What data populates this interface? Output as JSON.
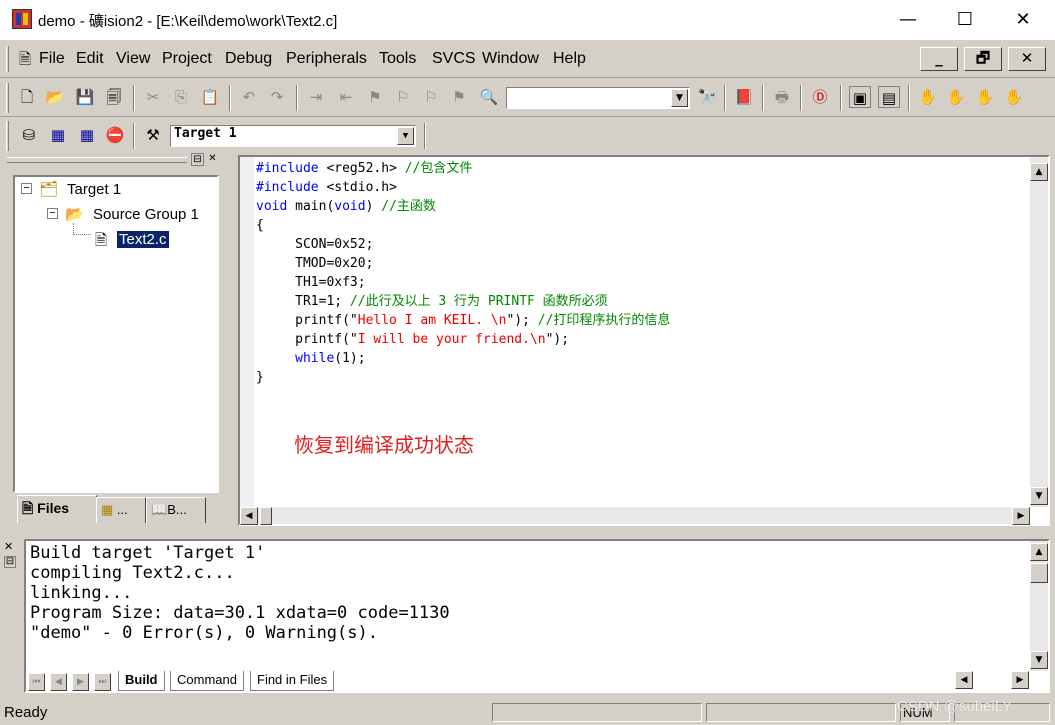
{
  "window": {
    "title": "demo  - 礦ision2 - [E:\\Keil\\demo\\work\\Text2.c]",
    "minimize": "—",
    "maximize": "☐",
    "close": "✕"
  },
  "menu": [
    "File",
    "Edit",
    "View",
    "Project",
    "Debug",
    "Peripherals",
    "Tools",
    "SVCS",
    "Window",
    "Help"
  ],
  "mdi": {
    "minimize": "_",
    "restore": "🗗",
    "close": "✕"
  },
  "toolbar": {
    "target_combo": "Target 1",
    "find_combo": ""
  },
  "project_tree": {
    "root": "Target 1",
    "group": "Source Group 1",
    "file": "Text2.c"
  },
  "project_tabs": [
    "Files",
    "...",
    "B..."
  ],
  "editor": {
    "lines": [
      [
        {
          "t": "#include",
          "c": "kw"
        },
        {
          "t": " <reg52.h> ",
          "c": ""
        },
        {
          "t": "//包含文件",
          "c": "cm"
        }
      ],
      [
        {
          "t": "#include",
          "c": "kw"
        },
        {
          "t": " <stdio.h>",
          "c": ""
        }
      ],
      [
        {
          "t": "void",
          "c": "kw"
        },
        {
          "t": " main(",
          "c": ""
        },
        {
          "t": "void",
          "c": "kw"
        },
        {
          "t": ") ",
          "c": ""
        },
        {
          "t": "//主函数",
          "c": "cm"
        }
      ],
      [
        {
          "t": "{",
          "c": ""
        }
      ],
      [
        {
          "t": "     SCON=0x52;",
          "c": ""
        }
      ],
      [
        {
          "t": "     TMOD=0x20;",
          "c": ""
        }
      ],
      [
        {
          "t": "     TH1=0xf3;",
          "c": ""
        }
      ],
      [
        {
          "t": "     TR1=1; ",
          "c": ""
        },
        {
          "t": "//此行及以上 3 行为 PRINTF 函数所必须",
          "c": "cm"
        }
      ],
      [
        {
          "t": "     printf(\"",
          "c": ""
        },
        {
          "t": "Hello I am KEIL. \\n",
          "c": "str"
        },
        {
          "t": "\"); ",
          "c": ""
        },
        {
          "t": "//打印程序执行的信息",
          "c": "cm"
        }
      ],
      [
        {
          "t": "     printf(\"",
          "c": ""
        },
        {
          "t": "I will be your friend.\\n",
          "c": "str"
        },
        {
          "t": "\");",
          "c": ""
        }
      ],
      [
        {
          "t": "     ",
          "c": ""
        },
        {
          "t": "while",
          "c": "kw"
        },
        {
          "t": "(1);",
          "c": ""
        }
      ],
      [
        {
          "t": "}",
          "c": ""
        }
      ]
    ],
    "annotation": "恢复到编译成功状态"
  },
  "output": {
    "lines": [
      "Build target 'Target 1'",
      "compiling Text2.c...",
      "linking...",
      "Program Size: data=30.1 xdata=0 code=1130",
      "\"demo\" - 0 Error(s), 0 Warning(s)."
    ],
    "tabs": [
      "Build",
      "Command",
      "Find in Files"
    ]
  },
  "status": {
    "text": "Ready",
    "num": "NUM",
    "watermark": "CSDN @subeiLY"
  }
}
